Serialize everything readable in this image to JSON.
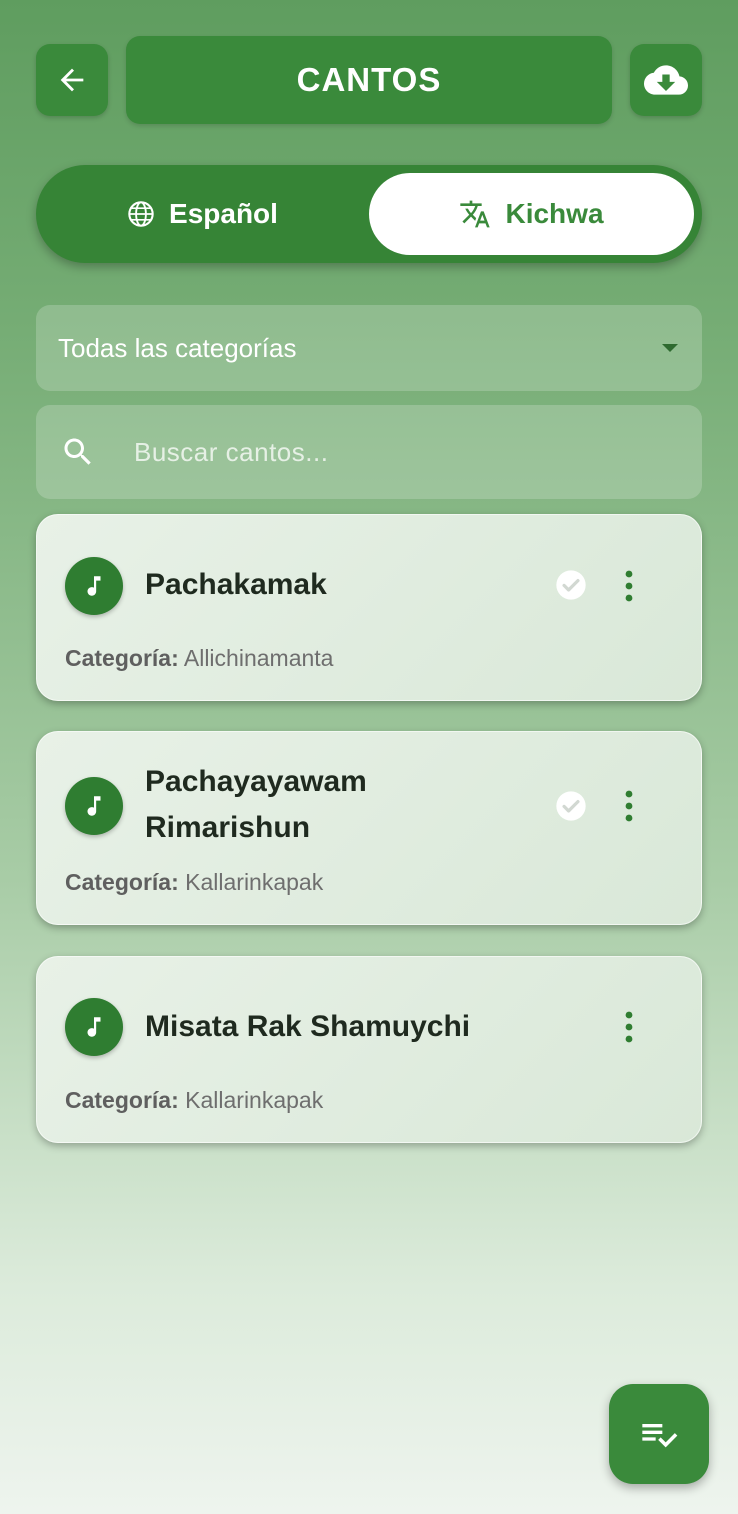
{
  "header": {
    "title": "CANTOS",
    "back_icon": "arrow-left-icon",
    "download_icon": "cloud-download-icon"
  },
  "language_toggle": {
    "options": [
      {
        "label": "Español",
        "icon": "globe-icon",
        "selected": false
      },
      {
        "label": "Kichwa",
        "icon": "translate-icon",
        "selected": true
      }
    ]
  },
  "category_filter": {
    "selected": "Todas las categorías"
  },
  "search": {
    "placeholder": "Buscar cantos...",
    "value": ""
  },
  "songs": [
    {
      "title": "Pachakamak",
      "category_label": "Categoría:",
      "category": "Allichinamanta",
      "done": true
    },
    {
      "title": "Pachayayawam Rimarishun",
      "category_label": "Categoría:",
      "category": "Kallarinkapak",
      "done": true
    },
    {
      "title": "Misata Rak Shamuychi",
      "category_label": "Categoría:",
      "category": "Kallarinkapak",
      "done": false
    }
  ],
  "fab": {
    "icon": "playlist-check-icon"
  },
  "colors": {
    "primary": "#3a8a3b",
    "primary_dark": "#2f7d31",
    "toggle_track": "#368436",
    "card_bg": "#e3eee2"
  }
}
